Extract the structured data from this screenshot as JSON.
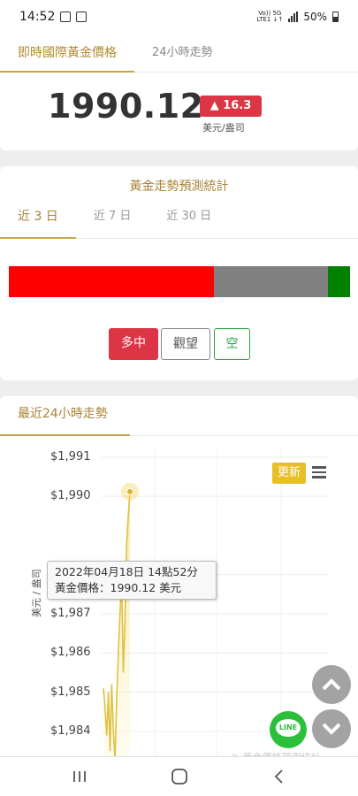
{
  "status_bar": {
    "time": "14:52",
    "network_top": "Vo)) 5G",
    "network_bottom": "LTE1 ↓↑",
    "battery": "50%"
  },
  "header": {
    "tabs": [
      {
        "label": "即時國際黃金價格",
        "active": true
      },
      {
        "label": "24小時走勢",
        "active": false
      }
    ],
    "price": "1990.12",
    "change": "▲ 16.3",
    "unit": "美元/盎司",
    "change_color": "#dc3545"
  },
  "forecast": {
    "title": "黃金走勢預測統計",
    "tabs": [
      {
        "label": "近 3 日",
        "active": true
      },
      {
        "label": "近 7 日",
        "active": false
      },
      {
        "label": "近 30 日",
        "active": false
      }
    ],
    "distribution": [
      {
        "name": "多中",
        "fraction": 0.6,
        "color": "#ff0000"
      },
      {
        "name": "觀望",
        "fraction": 0.335,
        "color": "#808080"
      },
      {
        "name": "空",
        "fraction": 0.065,
        "color": "#008000"
      }
    ],
    "buttons": {
      "bull": "多中",
      "wait": "觀望",
      "bear": "空"
    }
  },
  "trend": {
    "tab_label": "最近24小時走勢",
    "refresh_label": "更新",
    "y_axis_label": "美元 / 盎司",
    "tooltip_line1": "2022年04月18日 14點52分",
    "tooltip_line2": "黃金價格：1990.12 美元",
    "watermark": "© 黃金價格預測統計",
    "chart_data": {
      "type": "area",
      "ylabel": "美元 / 盎司",
      "y_ticks": [
        "$1,991",
        "$1,990",
        "$1,988",
        "$1,987",
        "$1,986",
        "$1,985",
        "$1,984"
      ],
      "ylim": [
        1983.3,
        1991.2
      ],
      "series": [
        {
          "values": [
            1985.1,
            1984.6,
            1983.9,
            1985.0,
            1983.5,
            1985.2,
            1984.0,
            1983.3,
            1984.8,
            1986.0,
            1987.0,
            1987.9,
            1985.5,
            1986.8,
            1988.8,
            1989.5,
            1990.12
          ],
          "color": "#e0c040"
        }
      ],
      "highlight": {
        "value": 1990.12
      }
    }
  },
  "colors": {
    "gold": "#c9a54a",
    "line_green": "#2bbf3a"
  }
}
